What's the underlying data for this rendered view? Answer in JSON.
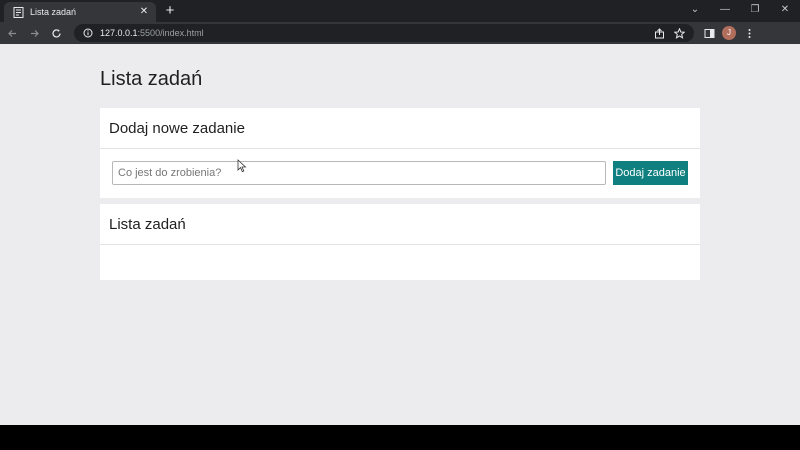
{
  "browser": {
    "tab": {
      "title": "Lista zadań",
      "close_glyph": "✕"
    },
    "new_tab_glyph": "+",
    "window_controls": {
      "dropdown": "⌄",
      "minimize": "—",
      "restore": "❐",
      "close": "✕"
    },
    "url": {
      "host": "127.0.0.1",
      "rest": ":5500/index.html"
    },
    "profile_initial": "J",
    "icons": [
      "back-icon",
      "forward-icon",
      "reload-icon",
      "info-icon",
      "share-icon",
      "star-icon",
      "sidebar-icon",
      "menu-icon"
    ]
  },
  "page": {
    "title": "Lista zadań",
    "add_card": {
      "header": "Dodaj nowe zadanie",
      "input_placeholder": "Co jest do zrobienia?",
      "input_value": "",
      "button_label": "Dodaj zadanie"
    },
    "list_card": {
      "header": "Lista zadań",
      "items": []
    }
  },
  "colors": {
    "accent_button": "#0f7f7f",
    "page_background": "#ecebed",
    "chrome_dark": "#202124",
    "chrome_toolbar": "#35363a"
  }
}
